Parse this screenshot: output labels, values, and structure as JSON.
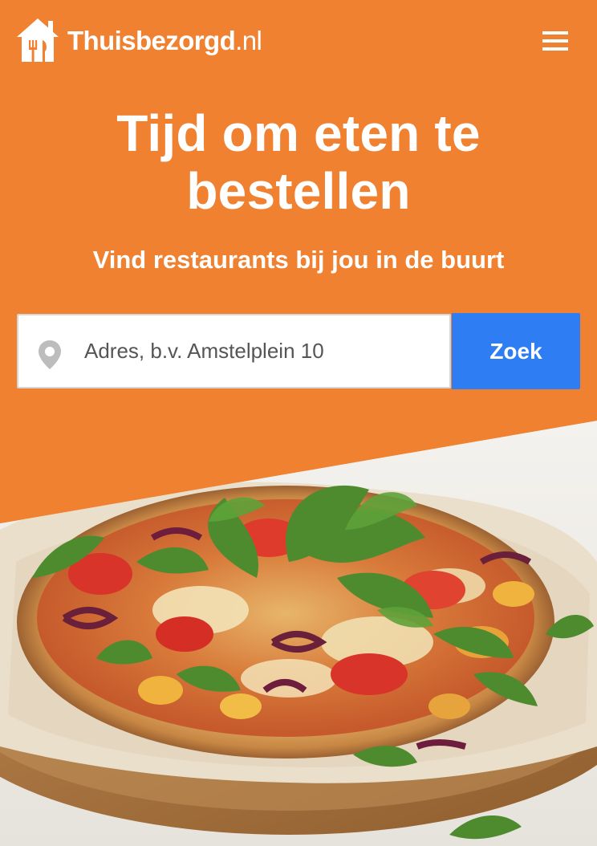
{
  "header": {
    "brand_name": "Thuisbezorgd",
    "brand_tld": ".nl",
    "logo_icon": "house-fork-knife-icon",
    "menu_icon": "hamburger-menu-icon"
  },
  "hero": {
    "title": "Tijd om eten te bestellen",
    "subtitle": "Vind restaurants bij jou in de buurt",
    "image": "pizza-photo"
  },
  "search": {
    "placeholder": "Adres, b.v. Amstelplein 10",
    "value": "",
    "button_label": "Zoek",
    "pin_icon": "location-pin-icon"
  },
  "colors": {
    "brand_orange": "#ef8131",
    "search_button_blue": "#2f7df2",
    "text_white": "#ffffff"
  }
}
